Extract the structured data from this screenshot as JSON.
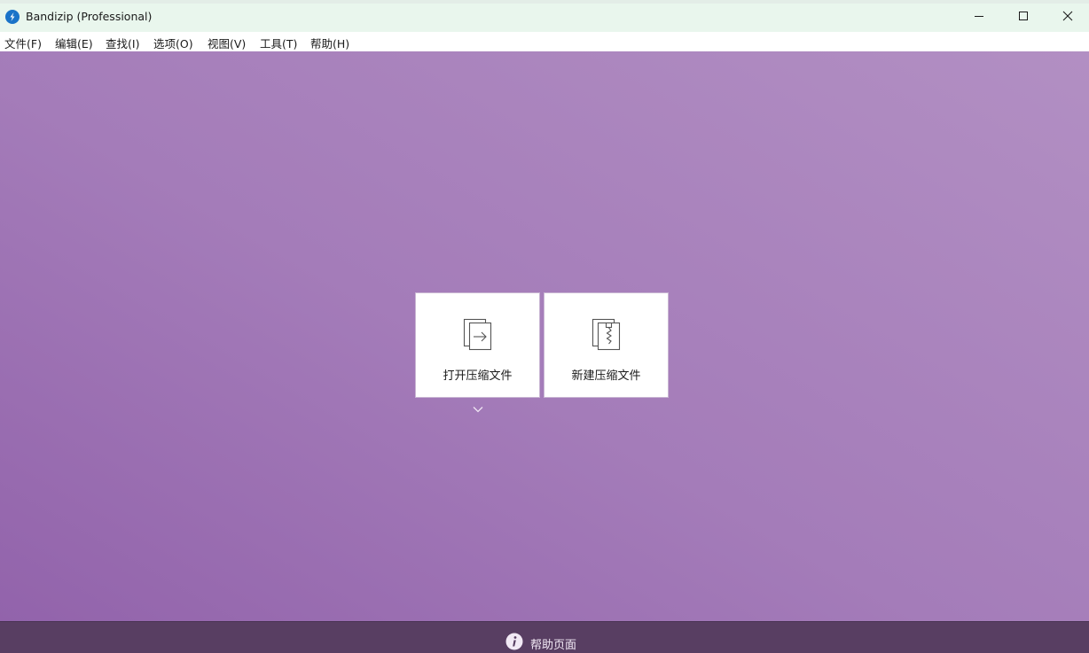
{
  "window": {
    "title": "Bandizip (Professional)"
  },
  "menu": {
    "items": [
      "文件(F)",
      "编辑(E)",
      "查找(I)",
      "选项(O)",
      "视图(V)",
      "工具(T)",
      "帮助(H)"
    ]
  },
  "main": {
    "open_archive_label": "打开压缩文件",
    "new_archive_label": "新建压缩文件"
  },
  "footer": {
    "help_label": "帮助页面"
  },
  "colors": {
    "titlebar_bg": "#e9f6ed",
    "main_bg_start": "#9263ab",
    "main_bg_end": "#b28fc3",
    "footer_bg": "#583e62",
    "accent": "#1a73c8"
  },
  "icons": {
    "app": "bandizip-logo-icon",
    "minimize": "minimize-icon",
    "maximize": "maximize-icon",
    "close": "close-icon",
    "open_archive": "open-archive-icon",
    "new_archive": "new-archive-icon",
    "more": "chevron-down-icon",
    "help": "info-icon"
  }
}
